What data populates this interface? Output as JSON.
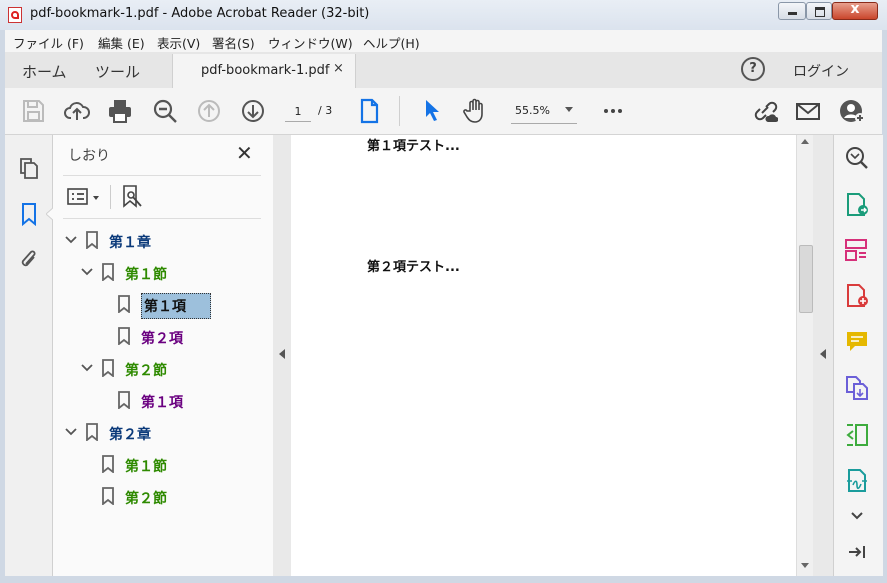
{
  "window": {
    "title": "pdf-bookmark-1.pdf - Adobe Acrobat Reader (32-bit)"
  },
  "menu": [
    "ファイル (F)",
    "編集 (E)",
    "表示(V)",
    "署名(S)",
    "ウィンドウ(W)",
    "ヘルプ(H)"
  ],
  "tabs": {
    "home": "ホーム",
    "tools": "ツール",
    "document": "pdf-bookmark-1.pdf",
    "close_glyph": "×",
    "help_glyph": "?",
    "login": "ログイン"
  },
  "toolbar": {
    "page_current": "1",
    "page_total": "/ 3",
    "zoom": "55.5%"
  },
  "bookmarks_panel": {
    "title": "しおり",
    "close_glyph": "✕",
    "items": [
      {
        "label": "第１章",
        "level": 0,
        "expanded": true,
        "color": "#0b3a7a"
      },
      {
        "label": "第１節",
        "level": 1,
        "expanded": true,
        "color": "#2e8a00"
      },
      {
        "label": "第１項",
        "level": 2,
        "selected": true,
        "color": "#111111"
      },
      {
        "label": "第２項",
        "level": 2,
        "color": "#6a0080"
      },
      {
        "label": "第２節",
        "level": 1,
        "expanded": true,
        "color": "#2e8a00"
      },
      {
        "label": "第１項",
        "level": 2,
        "color": "#6a0080"
      },
      {
        "label": "第２章",
        "level": 0,
        "expanded": true,
        "color": "#0b3a7a"
      },
      {
        "label": "第１節",
        "level": 1,
        "color": "#2e8a00"
      },
      {
        "label": "第２節",
        "level": 1,
        "color": "#2e8a00"
      }
    ]
  },
  "document": {
    "lines": [
      "第１項テスト...",
      "第２項テスト..."
    ]
  },
  "colors": {
    "accent": "#1473e6"
  }
}
